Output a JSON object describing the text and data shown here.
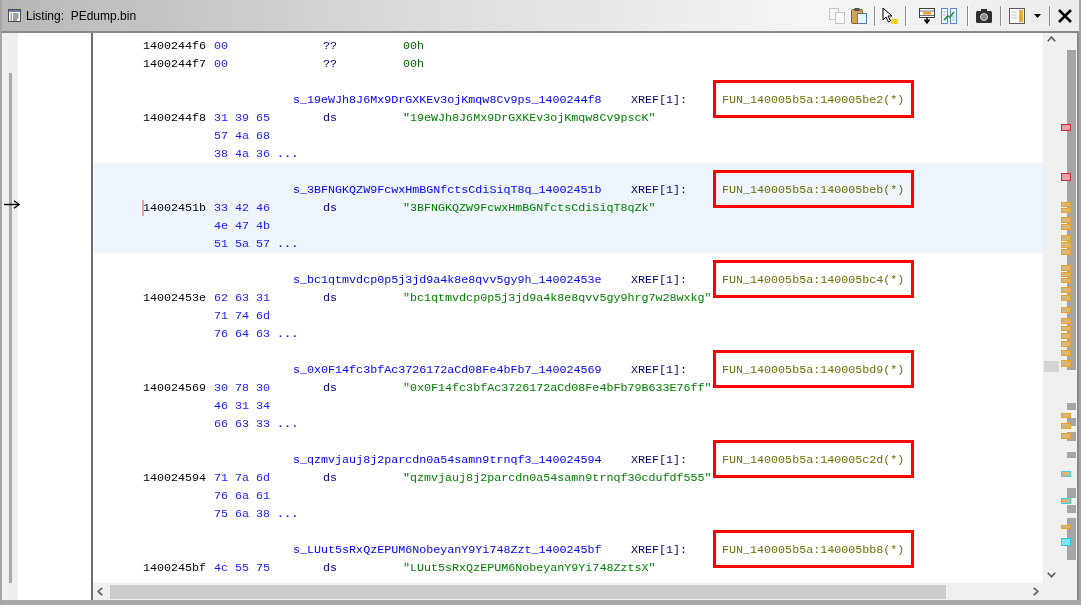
{
  "window": {
    "title": "Listing:  PEdump.bin"
  },
  "listing": {
    "lines": [
      {
        "address": "1400244f6",
        "bytes": "00",
        "mnemonic": "??",
        "operand": "00h"
      },
      {
        "address": "1400244f7",
        "bytes": "00",
        "mnemonic": "??",
        "operand": "00h"
      }
    ],
    "strings": [
      {
        "label": "s_19eWJh8J6Mx9DrGXKEv3ojKmqw8Cv9ps_1400244f8",
        "xref_label": "XREF[1]:",
        "xref": "FUN_140005b5a:140005be2(*)",
        "highlighted": true,
        "selected": false,
        "address": "1400244f8",
        "bytes": [
          "31 39 65",
          "57 4a 68",
          "38 4a 36"
        ],
        "more": "...",
        "mnemonic": "ds",
        "value": "\"19eWJh8J6Mx9DrGXKEv3ojKmqw8Cv9pscK\""
      },
      {
        "label": "s_3BFNGKQZW9FcwxHmBGNfctsCdiSiqT8q_14002451b",
        "xref_label": "XREF[1]:",
        "xref": "FUN_140005b5a:140005beb(*)",
        "highlighted": true,
        "selected": true,
        "address": "14002451b",
        "bytes": [
          "33 42 46",
          "4e 47 4b",
          "51 5a 57"
        ],
        "more": "...",
        "mnemonic": "ds",
        "value": "\"3BFNGKQZW9FcwxHmBGNfctsCdiSiqT8qZk\""
      },
      {
        "label": "s_bc1qtmvdcp0p5j3jd9a4k8e8qvv5gy9h_14002453e",
        "xref_label": "XREF[1]:",
        "xref": "FUN_140005b5a:140005bc4(*)",
        "highlighted": true,
        "selected": false,
        "address": "14002453e",
        "bytes": [
          "62 63 31",
          "71 74 6d",
          "76 64 63"
        ],
        "more": "...",
        "mnemonic": "ds",
        "value": "\"bc1qtmvdcp0p5j3jd9a4k8e8qvv5gy9hrg7w28wxkg\""
      },
      {
        "label": "s_0x0F14fc3bfAc3726172aCd08Fe4bFb7_140024569",
        "xref_label": "XREF[1]:",
        "xref": "FUN_140005b5a:140005bd9(*)",
        "highlighted": true,
        "selected": false,
        "address": "140024569",
        "bytes": [
          "30 78 30",
          "46 31 34",
          "66 63 33"
        ],
        "more": "...",
        "mnemonic": "ds",
        "value": "\"0x0F14fc3bfAc3726172aCd08Fe4bFb79B633E76ff\""
      },
      {
        "label": "s_qzmvjauj8j2parcdn0a54samn9trnqf3_140024594",
        "xref_label": "XREF[1]:",
        "xref": "FUN_140005b5a:140005c2d(*)",
        "highlighted": true,
        "selected": false,
        "address": "140024594",
        "bytes": [
          "71 7a 6d",
          "76 6a 61",
          "75 6a 38"
        ],
        "more": "...",
        "mnemonic": "ds",
        "value": "\"qzmvjauj8j2parcdn0a54samn9trnqf30cdufdf555\""
      },
      {
        "label": "s_LUut5sRxQzEPUM6NobeyanY9Yi748Zzt_1400245bf",
        "xref_label": "XREF[1]:",
        "xref": "FUN_140005b5a:140005bb8(*)",
        "highlighted": true,
        "selected": false,
        "address": "1400245bf",
        "bytes": [
          "4c 55 75"
        ],
        "mnemonic": "ds",
        "value": "\"LUut5sRxQzEPUM6NobeyanY9Yi748ZztsX\""
      }
    ]
  }
}
